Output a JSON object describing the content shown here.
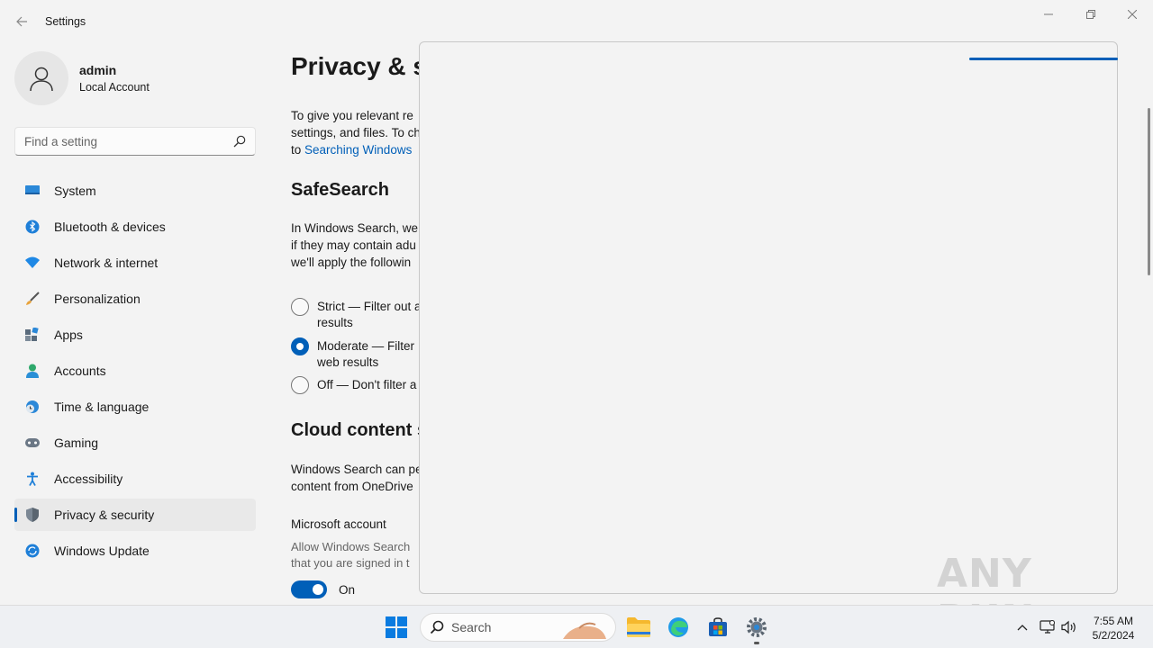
{
  "window": {
    "title": "Settings"
  },
  "profile": {
    "name": "admin",
    "account_type": "Local Account"
  },
  "search": {
    "placeholder": "Find a setting"
  },
  "nav": {
    "items": [
      {
        "label": "System",
        "icon": "monitor-icon"
      },
      {
        "label": "Bluetooth & devices",
        "icon": "bluetooth-icon"
      },
      {
        "label": "Network & internet",
        "icon": "wifi-icon"
      },
      {
        "label": "Personalization",
        "icon": "brush-icon"
      },
      {
        "label": "Apps",
        "icon": "apps-icon"
      },
      {
        "label": "Accounts",
        "icon": "person-icon"
      },
      {
        "label": "Time & language",
        "icon": "globe-clock-icon"
      },
      {
        "label": "Gaming",
        "icon": "gamepad-icon"
      },
      {
        "label": "Accessibility",
        "icon": "accessibility-icon"
      },
      {
        "label": "Privacy & security",
        "icon": "shield-icon",
        "selected": true
      },
      {
        "label": "Windows Update",
        "icon": "update-icon"
      }
    ]
  },
  "content": {
    "title": "Privacy & se",
    "intro_line1": "To give you relevant re",
    "intro_line2": "settings, and files. To ch",
    "intro_line3_prefix": "to ",
    "intro_link": "Searching Windows",
    "safesearch": {
      "heading": "SafeSearch",
      "desc_line1": "In Windows Search, we",
      "desc_line2": "if they may contain adu",
      "desc_line3": "we'll apply the followin",
      "options": [
        {
          "line1": "Strict — Filter out a",
          "line2": "results",
          "selected": false
        },
        {
          "line1": "Moderate — Filter",
          "line2": "web results",
          "selected": true
        },
        {
          "line1": "Off — Don't filter a",
          "line2": "",
          "selected": false
        }
      ]
    },
    "cloud": {
      "heading": "Cloud content s",
      "desc_line1": "Windows Search can pe",
      "desc_line2": "content from OneDrive",
      "ms_account_label": "Microsoft account",
      "ms_desc_line1": "Allow Windows Search",
      "ms_desc_line2": "that you are signed in t",
      "toggle_state": "On"
    }
  },
  "taskbar": {
    "search_placeholder": "Search",
    "time": "7:55 AM",
    "date": "5/2/2024"
  },
  "watermark": {
    "text": "ANY RUN"
  },
  "colors": {
    "accent": "#005fb8",
    "background": "#f3f3f3"
  }
}
